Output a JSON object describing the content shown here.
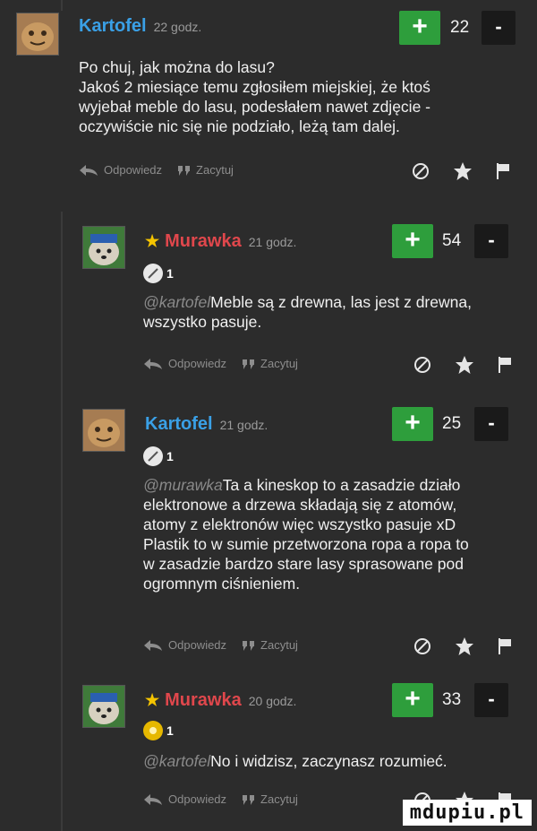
{
  "comments": [
    {
      "author": "Kartofel",
      "time": "22 godz.",
      "moderator": false,
      "votes": "22",
      "text_lines": [
        "Po chuj, jak można do lasu?",
        "Jakoś 2 miesiące temu zgłosiłem miejskiej, że ktoś",
        "wyjebał meble do lasu, podesłałem nawet zdjęcie -",
        "oczywiście nic się nie podziało, leżą tam dalej."
      ],
      "reply_label": "Odpowiedz",
      "quote_label": "Zacytuj"
    },
    {
      "author": "Murawka",
      "time": "21 godz.",
      "moderator": true,
      "votes": "54",
      "badge_count": "1",
      "mention": "@kartofel",
      "text_lines": [
        "Meble są z drewna, las jest z drewna,",
        "wszystko pasuje."
      ],
      "reply_label": "Odpowiedz",
      "quote_label": "Zacytuj"
    },
    {
      "author": "Kartofel",
      "time": "21 godz.",
      "moderator": false,
      "votes": "25",
      "badge_count": "1",
      "mention": "@murawka",
      "text_lines": [
        "Ta a kineskop to a zasadzie działo",
        "elektronowe a drzewa składają się z atomów,",
        "atomy z elektronów więc wszystko pasuje xD",
        "Plastik to w sumie przetworzona ropa a ropa to",
        "w zasadzie bardzo stare lasy sprasowane pod",
        "ogromnym ciśnieniem."
      ],
      "reply_label": "Odpowiedz",
      "quote_label": "Zacytuj"
    },
    {
      "author": "Murawka",
      "time": "20 godz.",
      "moderator": true,
      "votes": "33",
      "badge_count": "1",
      "mention": "@kartofel",
      "text_lines": [
        "No i widzisz, zaczynasz rozumieć."
      ],
      "reply_label": "Odpowiedz",
      "quote_label": "Zacytuj"
    }
  ],
  "vote_plus_symbol": "+",
  "vote_minus_symbol": "-",
  "moderator_star": "★",
  "watermark": "mdupiu.pl",
  "colors": {
    "background": "#2c2c2c",
    "author_blue": "#3aa0e6",
    "author_red": "#e0474c",
    "vote_green": "#2e9e3c",
    "vote_dark": "#1a1a1a",
    "muted": "#8d8d8d"
  },
  "icons": {
    "reply": "reply-arrow-icon",
    "quote": "quote-icon",
    "hide": "hide-icon",
    "favorite": "star-icon",
    "report": "flag-icon",
    "badge": "medal-icon"
  }
}
